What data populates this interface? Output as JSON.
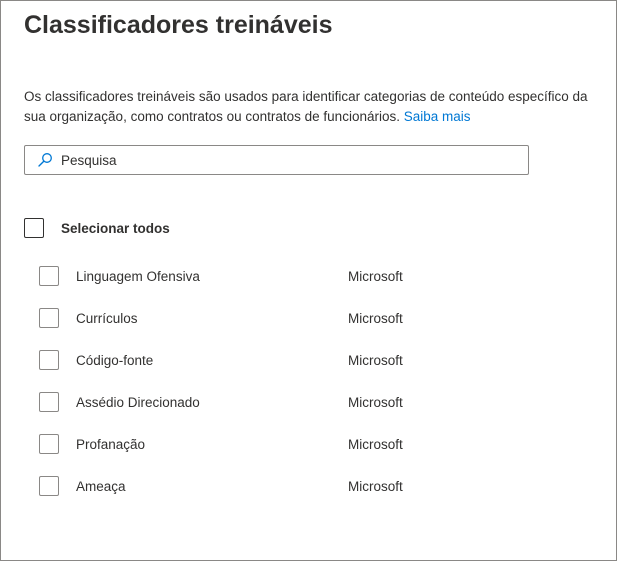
{
  "panel": {
    "title": "Classificadores treináveis",
    "description": "Os classificadores treináveis são usados para identificar categorias de conteúdo específico da sua organização, como contratos ou contratos de funcionários.",
    "learn_more": "Saiba mais"
  },
  "search": {
    "placeholder": "Pesquisa",
    "icon": "search-icon"
  },
  "select_all": {
    "label": "Selecionar todos",
    "checked": false
  },
  "classifiers": [
    {
      "name": "Linguagem Ofensiva",
      "publisher": "Microsoft",
      "checked": false
    },
    {
      "name": "Currículos",
      "publisher": "Microsoft",
      "checked": false
    },
    {
      "name": "Código-fonte",
      "publisher": "Microsoft",
      "checked": false
    },
    {
      "name": "Assédio Direcionado",
      "publisher": "Microsoft",
      "checked": false
    },
    {
      "name": "Profanação",
      "publisher": "Microsoft",
      "checked": false
    },
    {
      "name": "Ameaça",
      "publisher": "Microsoft",
      "checked": false
    }
  ],
  "colors": {
    "text": "#323130",
    "link": "#0078d4",
    "border": "#8a8886",
    "background": "#ffffff"
  }
}
